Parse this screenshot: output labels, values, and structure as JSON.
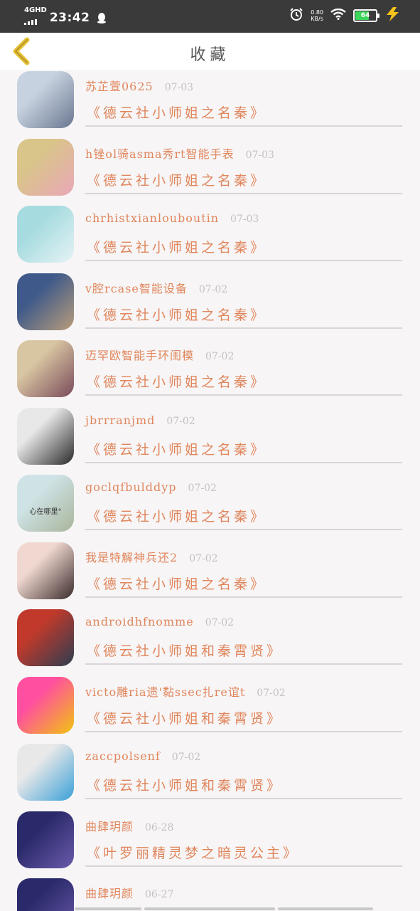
{
  "status_bar": {
    "network": "4GHD",
    "time": "23:42",
    "speed_value": "0.80",
    "speed_unit": "KB/s",
    "battery_level": "64"
  },
  "header": {
    "title": "收藏"
  },
  "favorites": [
    {
      "user": "苏芷萱0625",
      "date": "07-03",
      "title": "《德云社小师姐之名秦》",
      "avatar_colors": [
        "#c7d2e0",
        "#6b7790"
      ]
    },
    {
      "user": "h锉ol骑asma秀rt智能手表",
      "date": "07-03",
      "title": "《德云社小师姐之名秦》",
      "avatar_colors": [
        "#d9c48a",
        "#eaa7b8"
      ]
    },
    {
      "user": "chrhistxianlouboutin",
      "date": "07-03",
      "title": "《德云社小师姐之名秦》",
      "avatar_colors": [
        "#a6dbe0",
        "#e6f3f4"
      ]
    },
    {
      "user": "v腔rcase智能设备",
      "date": "07-02",
      "title": "《德云社小师姐之名秦》",
      "avatar_colors": [
        "#3f5a8a",
        "#b89c7a"
      ]
    },
    {
      "user": "迈罕欧智能手环闺模",
      "date": "07-02",
      "title": "《德云社小师姐之名秦》",
      "avatar_colors": [
        "#d8c5a2",
        "#7a4a5a"
      ]
    },
    {
      "user": "jbrrranjmd",
      "date": "07-02",
      "title": "《德云社小师姐之名秦》",
      "avatar_colors": [
        "#e8e8e8",
        "#2a2a2a"
      ]
    },
    {
      "user": "goclqfbulddyp",
      "date": "07-02",
      "title": "《德云社小师姐之名秦》",
      "avatar_colors": [
        "#cfe3e6",
        "#a8b49a"
      ],
      "avatar_caption": "心在哪里°"
    },
    {
      "user": "我是特解神兵还2",
      "date": "07-02",
      "title": "《德云社小师姐之名秦》",
      "avatar_colors": [
        "#f0d8d0",
        "#3a2a2a"
      ]
    },
    {
      "user": "androidhfnomme",
      "date": "07-02",
      "title": "《德云社小师姐和秦霄贤》",
      "avatar_colors": [
        "#c0392b",
        "#2c3e50"
      ]
    },
    {
      "user": "victo雕ria遗'黏ssec扎re谊t",
      "date": "07-02",
      "title": "《德云社小师姐和秦霄贤》",
      "avatar_colors": [
        "#ff4fa0",
        "#f1c40f"
      ]
    },
    {
      "user": "zaccpolsenf",
      "date": "07-02",
      "title": "《德云社小师姐和秦霄贤》",
      "avatar_colors": [
        "#e8e8e8",
        "#3aa0d8"
      ]
    },
    {
      "user": "曲肆玥颜",
      "date": "06-28",
      "title": "《叶罗丽精灵梦之暗灵公主》",
      "avatar_colors": [
        "#2a2a6a",
        "#6a5aaa"
      ]
    },
    {
      "user": "曲肆玥颜",
      "date": "06-27",
      "title": "",
      "avatar_colors": [
        "#2a2a6a",
        "#6a5aaa"
      ]
    }
  ],
  "colors": {
    "accent": "#e0865c",
    "date": "#c2c2c2",
    "back_arrow": "#e7c23a",
    "status_bar_bg": "#3a3a3a"
  }
}
